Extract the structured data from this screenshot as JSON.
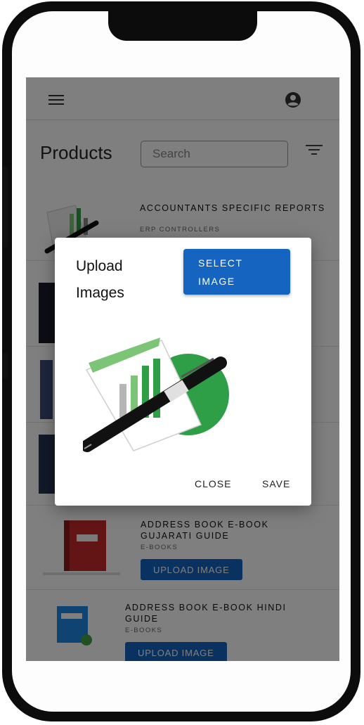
{
  "header": {
    "menu_icon": "hamburger-menu-icon",
    "account_icon": "account-circle-icon",
    "filter_icon": "filter-list-icon"
  },
  "page": {
    "title": "Products",
    "search_placeholder": "Search"
  },
  "products": [
    {
      "name": "ACCOUNTANTS SPECIFIC REPORTS",
      "category": "ERP CONTROLLERS"
    },
    {
      "name": "ADDRESS BOOK E-BOOK GUJARATI GUIDE",
      "category": "E-BOOKS",
      "button": "UPLOAD IMAGE"
    },
    {
      "name": "ADDRESS BOOK E-BOOK HINDI GUIDE",
      "category": "E-BOOKS",
      "button": "UPLOAD IMAGE"
    }
  ],
  "dialog": {
    "title": "Upload Images",
    "select_label": "SELECT IMAGE",
    "close_label": "CLOSE",
    "save_label": "SAVE"
  },
  "colors": {
    "primary": "#1565c0",
    "logo_green": "#2e9e47",
    "overlay": "rgba(0,0,0,0.5)"
  }
}
